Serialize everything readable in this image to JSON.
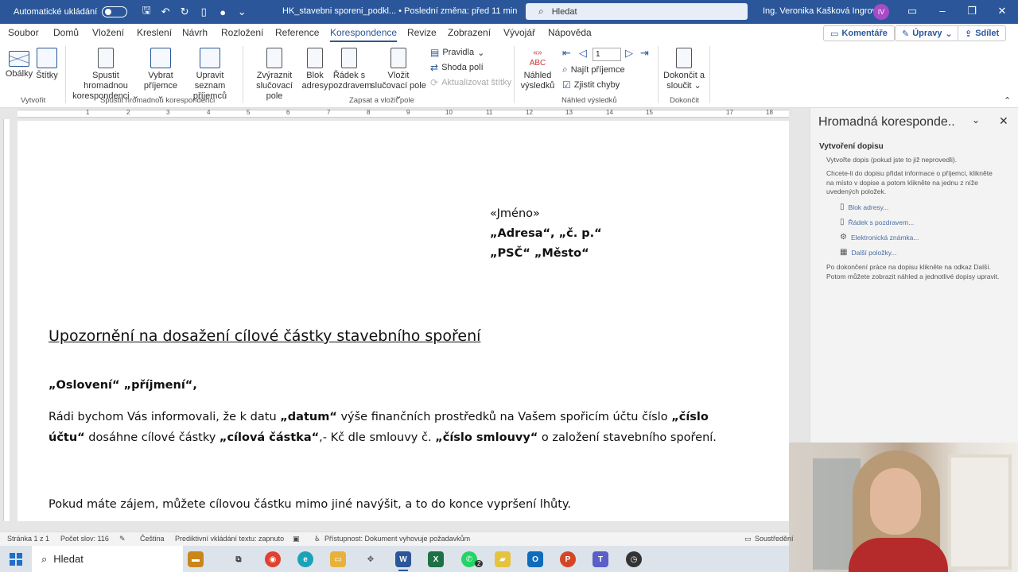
{
  "titlebar": {
    "autosave_label": "Automatické ukládání",
    "doc_title": "HK_stavebni sporeni_podkl... • Poslední změna: před 11 min",
    "search_placeholder": "Hledat",
    "user_name": "Ing. Veronika Kašková Ingrová",
    "user_initials": "IV"
  },
  "menu": {
    "tabs": [
      "Soubor",
      "Domů",
      "Vložení",
      "Kreslení",
      "Návrh",
      "Rozložení",
      "Reference",
      "Korespondence",
      "Revize",
      "Zobrazení",
      "Vývojář",
      "Nápověda"
    ],
    "active_tab": "Korespondence",
    "comments_label": "Komentáře",
    "edits_label": "Úpravy",
    "share_label": "Sdílet"
  },
  "ribbon": {
    "create": {
      "envelopes": "Obálky",
      "labels": "Štítky",
      "group": "Vytvořit"
    },
    "start_merge": {
      "start": "Spustit hromadnou korespondenci",
      "select": "Vybrat příjemce",
      "edit_list": "Upravit seznam příjemců",
      "group": "Spustit hromadnou korespondenci"
    },
    "write_insert": {
      "highlight": "Zvýraznit slučovací pole",
      "address_block": "Blok adresy",
      "greeting": "Řádek s pozdravem",
      "insert_field": "Vložit slučovací pole",
      "rules": "Pravidla",
      "match_fields": "Shoda polí",
      "update_labels": "Aktualizovat štítky",
      "group": "Zapsat a vložit pole"
    },
    "preview": {
      "preview_results": "Náhled výsledků",
      "record": "1",
      "find_recipient": "Najít příjemce",
      "check_errors": "Zjistit chyby",
      "group": "Náhled výsledků"
    },
    "finish": {
      "finish_merge": "Dokončit a sloučit",
      "group": "Dokončit"
    }
  },
  "document": {
    "address": {
      "line1": "«Jméno»",
      "line2": "„Adresa“, „č. p.“",
      "line3": "„PSČ“ „Město“"
    },
    "heading": "Upozornění na dosažení cílové částky stavebního spoření",
    "salutation": "„Oslovení“ „příjmení“,",
    "para1": {
      "t1": "Rádi bychom Vás informovali, že k datu ",
      "b1": "„datum“",
      "t2": " výše finančních prostředků na Vašem spořicím účtu číslo ",
      "b2": "„číslo účtu“",
      "t3": " dosáhne cílové částky ",
      "b3": "„cílová částka“",
      "t4": ",- Kč dle smlouvy č. ",
      "b4": "„číslo smlouvy“",
      "t5": " o založení stavebního spoření."
    },
    "para2": "Pokud máte zájem, můžete cílovou částku mimo jiné navýšit, a to do konce vypršení lhůty."
  },
  "pane": {
    "title": "Hromadná koresponde..",
    "section": "Vytvoření dopisu",
    "text1": "Vytvořte dopis (pokud jste to již neprovedli).",
    "text2": "Chcete-li do dopisu přidat informace o příjemci, klikněte na místo v dopise a potom klikněte na jednu z níže uvedených položek.",
    "links": [
      "Blok adresy...",
      "Řádek s pozdravem...",
      "Elektronická známka...",
      "Další položky..."
    ],
    "text3": "Po dokončení práce na dopisu klikněte na odkaz Další. Potom můžete zobrazit náhled a jednotlivé dopisy upravit."
  },
  "statusbar": {
    "page": "Stránka 1 z 1",
    "words": "Počet slov: 116",
    "language": "Čeština",
    "predictive": "Prediktivní vkládání textu: zapnuto",
    "accessibility": "Přístupnost: Dokument vyhovuje požadavkům",
    "focus": "Soustředění"
  },
  "taskbar": {
    "search_placeholder": "Hledat",
    "whatsapp_badge": "2"
  },
  "colors": {
    "accent": "#2b579a",
    "titlebar": "#2b579a",
    "pane_link": "#4a6fa5"
  }
}
